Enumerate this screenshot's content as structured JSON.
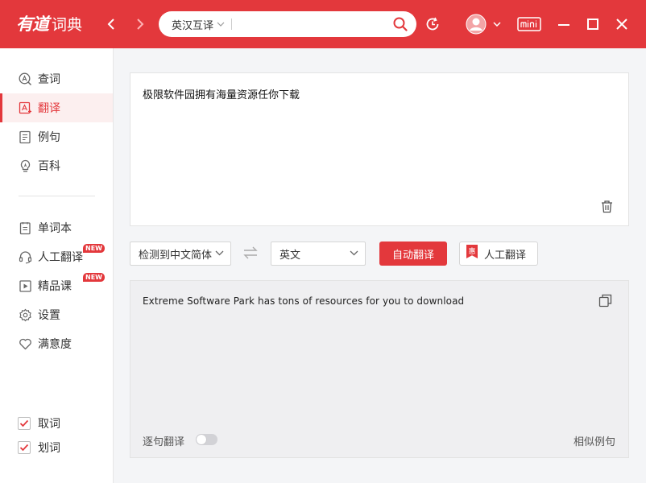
{
  "app": {
    "logo_mark": "有道",
    "logo_text": "词典"
  },
  "search": {
    "mode": "英汉互译",
    "value": ""
  },
  "sidebar": {
    "items": [
      {
        "label": "查词"
      },
      {
        "label": "翻译"
      },
      {
        "label": "例句"
      },
      {
        "label": "百科"
      },
      {
        "label": "单词本"
      },
      {
        "label": "人工翻译",
        "badge": "NEW"
      },
      {
        "label": "精品课",
        "badge": "NEW"
      },
      {
        "label": "设置"
      },
      {
        "label": "满意度"
      }
    ],
    "checks": [
      {
        "label": "取词",
        "checked": true
      },
      {
        "label": "划词",
        "checked": true
      }
    ]
  },
  "translate": {
    "source_text": "极限软件园拥有海量资源任你下载",
    "source_lang": "检测到中文简体",
    "target_lang": "英文",
    "auto_button": "自动翻译",
    "human_button": "人工翻译",
    "human_badge": "惠",
    "result_text": "Extreme Software Park has tons of resources for you to download",
    "sentence_toggle": "逐句翻译",
    "sentence_toggle_on": false,
    "similar_examples": "相似例句"
  },
  "colors": {
    "brand": "#e3383c",
    "sidebar_active_bg": "#fcefef",
    "output_bg": "#efeff1"
  }
}
